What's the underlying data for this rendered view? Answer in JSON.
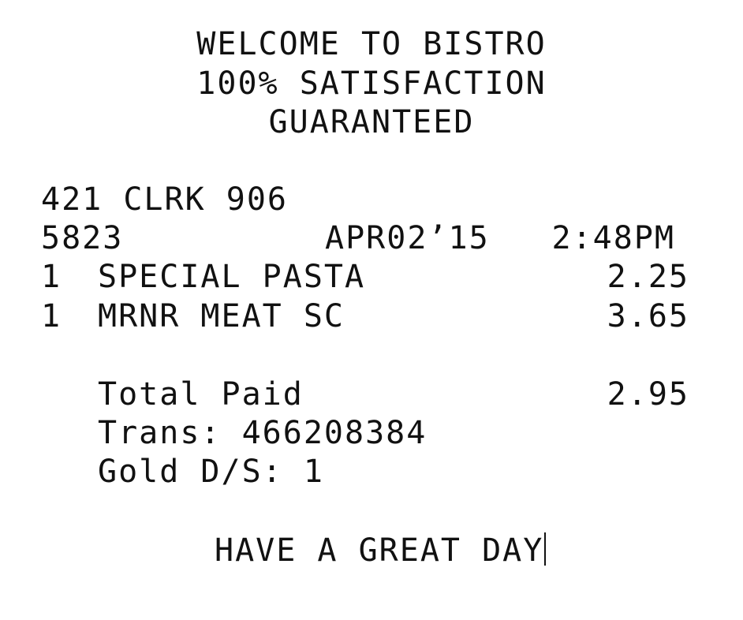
{
  "header": {
    "line1": "WELCOME TO BISTRO",
    "line2": "100% SATISFACTION",
    "line3": "GUARANTEED"
  },
  "meta": {
    "store_clerk": "421 CLRK 906",
    "check_number": "5823",
    "date": "APR02’15",
    "time": "2:48PM"
  },
  "items": [
    {
      "qty": "1",
      "name": "SPECIAL PASTA",
      "price": "2.25"
    },
    {
      "qty": "1",
      "name": "MRNR MEAT SC",
      "price": "3.65"
    }
  ],
  "summary": {
    "total_label": "Total Paid",
    "total_value": "2.95",
    "trans": "Trans: 466208384",
    "gold": "Gold D/S: 1"
  },
  "footer": {
    "message": "HAVE A GREAT DAY"
  }
}
